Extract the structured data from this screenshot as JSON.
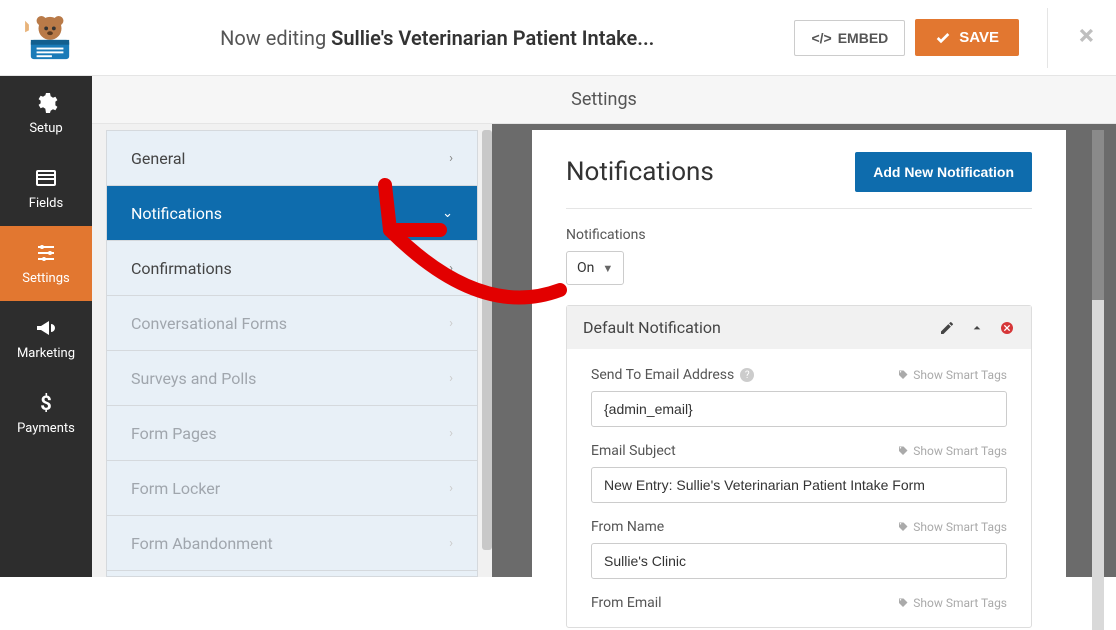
{
  "header": {
    "editing_prefix": "Now editing ",
    "form_name": "Sullie's Veterinarian Patient Intake...",
    "embed_label": "EMBED",
    "save_label": "SAVE"
  },
  "rail": {
    "setup": "Setup",
    "fields": "Fields",
    "settings": "Settings",
    "marketing": "Marketing",
    "payments": "Payments"
  },
  "settings_title": "Settings",
  "menu": {
    "general": "General",
    "notifications": "Notifications",
    "confirmations": "Confirmations",
    "conversational": "Conversational Forms",
    "surveys": "Surveys and Polls",
    "formpages": "Form Pages",
    "formlocker": "Form Locker",
    "formabandon": "Form Abandonment"
  },
  "panel": {
    "title": "Notifications",
    "add_label": "Add New Notification",
    "notifications_label": "Notifications",
    "notifications_status": "On",
    "block_title": "Default Notification",
    "smart_tags_label": "Show Smart Tags",
    "fields": {
      "send_to_label": "Send To Email Address",
      "send_to_value": "{admin_email}",
      "subject_label": "Email Subject",
      "subject_value": "New Entry: Sullie's Veterinarian Patient Intake Form",
      "from_name_label": "From Name",
      "from_name_value": "Sullie's Clinic",
      "from_email_label": "From Email"
    }
  }
}
